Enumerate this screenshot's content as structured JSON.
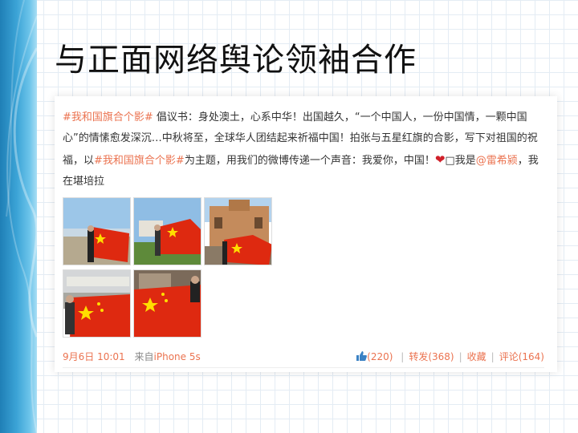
{
  "slide": {
    "title": "与正面网络舆论领袖合作"
  },
  "post": {
    "tag": "#我和国旗合个影#",
    "text_1": " 倡议书：身处澳土，心系中华！出国越久，“一个中国人，一份中国情，一颗中国心”的情愫愈发深沉…中秋将至，全球华人团结起来祈福中国！拍张与五星红旗的合影，写下对祖国的祝福，以",
    "tag_2": "#我和国旗合个影#",
    "text_2": "为主题，用我们的微博传递一个声音：我爱你，中国！",
    "heart": "❤",
    "text_3": "□我是",
    "mention": "@雷希颍",
    "text_4": "，我在堪培拉"
  },
  "footer": {
    "time": "9月6日 10:01",
    "from_label": "来自",
    "source": "iPhone 5s",
    "like": "(220)",
    "repost": "转发(368)",
    "favorite": "收藏",
    "comment": "评论(164)",
    "separator": "|"
  },
  "icons": {
    "like": "thumbs-up-icon",
    "heart": "heart-icon"
  },
  "colors": {
    "accent": "#eb7350",
    "flag_red": "#de2910",
    "flag_star": "#ffde00",
    "band_blue": "#1f7fb6"
  }
}
